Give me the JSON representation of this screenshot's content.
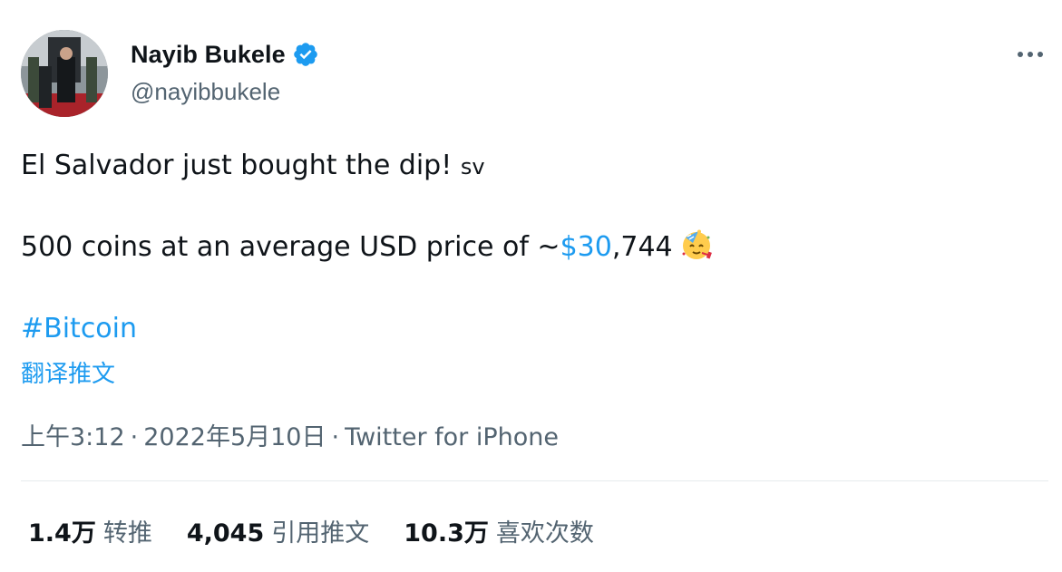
{
  "author": {
    "display_name": "Nayib Bukele",
    "handle": "@nayibbukele",
    "verified": true,
    "avatar_icon": "profile-photo-avatar",
    "verified_icon": "verified-badge-icon"
  },
  "more_icon": "more-options-icon",
  "tweet": {
    "line1_text": "El Salvador just bought the dip!",
    "line1_flag": "sv",
    "line2_prefix": "500 coins at an average USD price of ~",
    "line2_cashtag": "$30",
    "line2_suffix": ",744",
    "line2_emoji": "partying-face-emoji",
    "hashtag": "#Bitcoin"
  },
  "translate_label": "翻译推文",
  "meta": {
    "time": "上午3:12",
    "separator": "·",
    "date": "2022年5月10日",
    "source": "Twitter for iPhone"
  },
  "stats": [
    {
      "value": "1.4万",
      "label": "转推"
    },
    {
      "value": "4,045",
      "label": "引用推文"
    },
    {
      "value": "10.3万",
      "label": "喜欢次数"
    }
  ],
  "colors": {
    "link": "#1d9bf0",
    "text": "#0f1419",
    "secondary": "#536471",
    "divider": "#e6ebee"
  }
}
